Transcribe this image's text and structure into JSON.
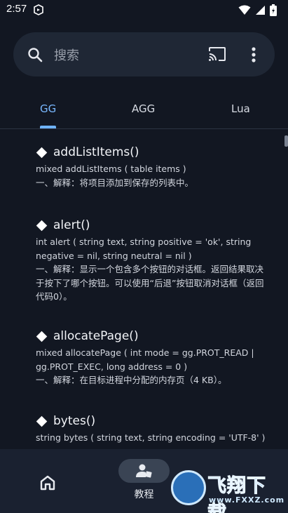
{
  "status_bar": {
    "time": "2:57"
  },
  "search": {
    "placeholder": "搜索"
  },
  "tabs": [
    {
      "label": "GG",
      "active": true
    },
    {
      "label": "AGG",
      "active": false
    },
    {
      "label": "Lua",
      "active": false
    }
  ],
  "entries": [
    {
      "title": "addListItems()",
      "signature": "mixed addListItems ( table items )",
      "description": "一、解释：将项目添加到保存的列表中。"
    },
    {
      "title": "alert()",
      "signature": "int alert ( string text, string positive = 'ok', string negative = nil, string neutral = nil )",
      "description": "一、解释：显示一个包含多个按钮的对话框。返回结果取决于按下了哪个按钮。可以使用“后退”按钮取消对话框（返回代码0）。"
    },
    {
      "title": "allocatePage()",
      "signature": "mixed allocatePage ( int mode = gg.PROT_READ | gg.PROT_EXEC, long address = 0 )",
      "description": "一、解释：在目标进程中分配的内存页（4 KB）。"
    },
    {
      "title": "bytes()",
      "signature": "string bytes ( string text, string encoding = 'UTF-8' )",
      "description": ""
    }
  ],
  "bottom_nav": {
    "tutorial_label": "教程"
  },
  "watermark": {
    "text": "飞翔下载",
    "url": "www.FXXZ.com"
  },
  "colors": {
    "background": "#121722",
    "accent": "#6fb3ff",
    "surface": "#1f2735"
  }
}
